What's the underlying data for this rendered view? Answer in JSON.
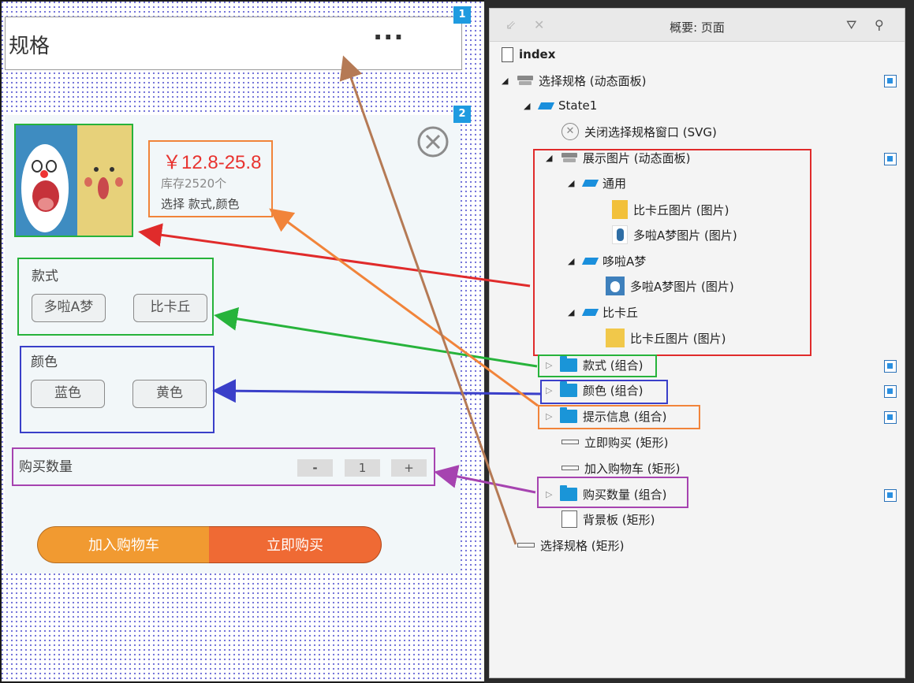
{
  "canvas": {
    "header": {
      "title": "规格",
      "more": "···"
    },
    "panel_tags": [
      "1",
      "2"
    ],
    "product": {
      "price": "￥12.8-25.8",
      "stock": "库存2520个",
      "hint": "选择 款式,颜色"
    },
    "style_group": {
      "label": "款式",
      "options": [
        "多啦A梦",
        "比卡丘"
      ]
    },
    "color_group": {
      "label": "颜色",
      "options": [
        "蓝色",
        "黄色"
      ]
    },
    "quantity": {
      "label": "购买数量",
      "minus": "-",
      "value": "1",
      "plus": "+"
    },
    "buttons": {
      "cart": "加入购物车",
      "buy": "立即购买"
    }
  },
  "outline": {
    "title": "概要: 页面",
    "tree": [
      {
        "label": "index",
        "bold": true
      },
      {
        "label": "选择规格 (动态面板)"
      },
      {
        "label": "State1"
      },
      {
        "label": "关闭选择规格窗口 (SVG)"
      },
      {
        "label": "展示图片 (动态面板)"
      },
      {
        "label": "通用"
      },
      {
        "label": "比卡丘图片 (图片)"
      },
      {
        "label": "多啦A梦图片 (图片)"
      },
      {
        "label": "哆啦A梦"
      },
      {
        "label": "多啦A梦图片 (图片)"
      },
      {
        "label": "比卡丘"
      },
      {
        "label": "比卡丘图片 (图片)"
      },
      {
        "label": "款式 (组合)"
      },
      {
        "label": "颜色 (组合)"
      },
      {
        "label": "提示信息 (组合)"
      },
      {
        "label": "立即购买 (矩形)"
      },
      {
        "label": "加入购物车 (矩形)"
      },
      {
        "label": "购买数量 (组合)"
      },
      {
        "label": "背景板 (矩形)"
      },
      {
        "label": "选择规格 (矩形)"
      }
    ]
  },
  "colors": {
    "green": "#27b33b",
    "orange": "#f1843a",
    "blue": "#3a3fc9",
    "purple": "#a643b0",
    "red": "#e02b2b",
    "brown": "#b57a55",
    "accent": "#1f9be0"
  }
}
